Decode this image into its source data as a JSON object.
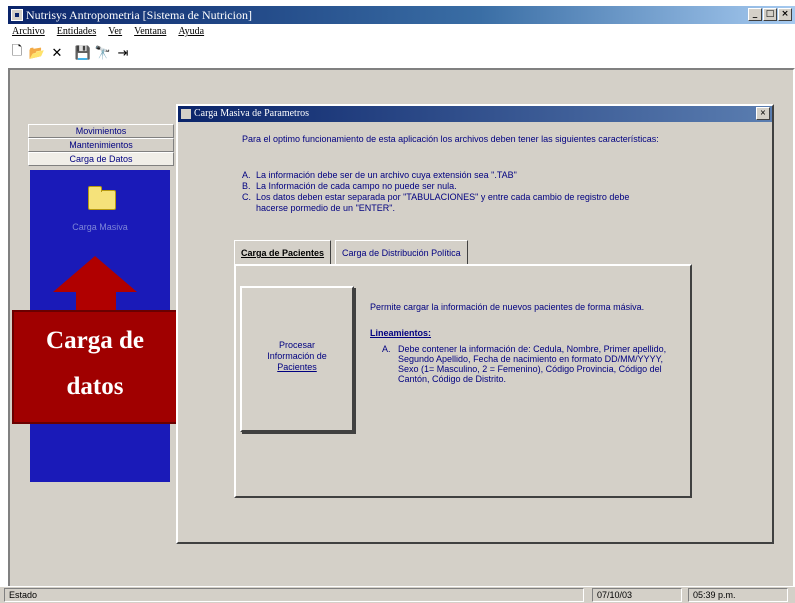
{
  "window": {
    "title": "Nutrisys Antropometria [Sistema de Nutricion]",
    "min": "_",
    "max": "□",
    "close": "×"
  },
  "menu": [
    "Archivo",
    "Entidades",
    "Ver",
    "Ventana",
    "Ayuda"
  ],
  "toolbar": [
    {
      "icon": "new-file-icon",
      "glyph": "🗋"
    },
    {
      "icon": "open-folder-icon",
      "glyph": "📂"
    },
    {
      "icon": "delete-icon",
      "glyph": "✕"
    },
    {
      "icon": "save-icon",
      "glyph": "💾"
    },
    {
      "icon": "binoculars-icon",
      "glyph": "🔭"
    },
    {
      "icon": "exit-icon",
      "glyph": "⇥"
    }
  ],
  "sidebar": {
    "items": [
      "Movimientos",
      "Mantenimientos",
      "Carga de Datos"
    ],
    "panel_label": "Carga Masiva"
  },
  "callout": {
    "line1": "Carga de",
    "line2": "datos"
  },
  "dialog": {
    "title": "Carga Masiva de Parametros",
    "close": "×",
    "intro": "Para el optimo funcionamiento de esta aplicación los archivos deben tener las siguientes características:",
    "requirements": [
      {
        "letter": "A.",
        "text": "La información debe ser de un archivo cuya extensión sea \".TAB\""
      },
      {
        "letter": "B.",
        "text": "La Información de cada campo no puede ser nula."
      },
      {
        "letter": "C.",
        "text": "Los datos deben estar separada por \"TABULACIONES\" y entre cada cambio de registro debe hacerse pormedio de un \"ENTER\"."
      }
    ],
    "tabs": [
      "Carga de Pacientes",
      "Carga de Distribución Política"
    ],
    "button": {
      "line1": "Procesar",
      "line2": "Información de",
      "line3": "Pacientes"
    },
    "description": "Permite cargar la información de nuevos pacientes de forma másiva.",
    "guidelines_label": "Lineamientos:",
    "guideline": {
      "letter": "A.",
      "text": "Debe contener la información de: Cedula, Nombre, Primer apellido, Segundo Apellido, Fecha de nacimiento en formato DD/MM/YYYY, Sexo (1= Masculino, 2 = Femenino), Código Provincia, Código del Cantón, Código de Distrito."
    }
  },
  "status": {
    "state": "Estado",
    "date": "07/10/03",
    "time": "05:39 p.m."
  }
}
